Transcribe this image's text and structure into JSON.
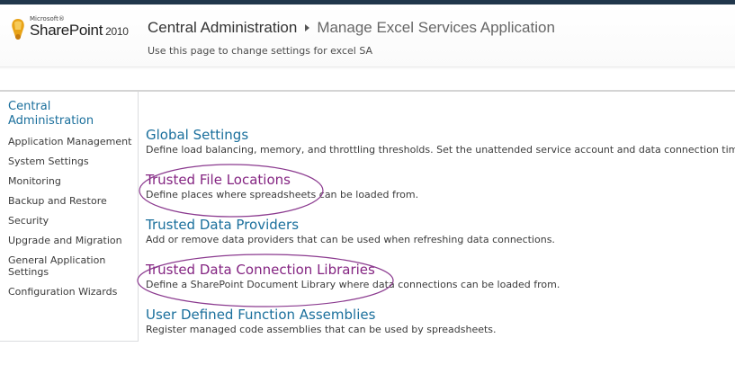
{
  "header": {
    "logo_microsoft": "Microsoft®",
    "logo_product": "SharePoint",
    "logo_year": "2010",
    "breadcrumb_root": "Central Administration",
    "breadcrumb_current": "Manage Excel Services Application",
    "page_description": "Use this page to change settings for excel SA"
  },
  "leftnav": {
    "heading": "Central Administration",
    "items": [
      "Application Management",
      "System Settings",
      "Monitoring",
      "Backup and Restore",
      "Security",
      "Upgrade and Migration",
      "General Application Settings",
      "Configuration Wizards"
    ]
  },
  "sections": [
    {
      "title": "Global Settings",
      "description": "Define load balancing, memory, and throttling thresholds. Set the unattended service account and data connection timeouts."
    },
    {
      "title": "Trusted File Locations",
      "description": "Define places where spreadsheets can be loaded from."
    },
    {
      "title": "Trusted Data Providers",
      "description": "Add or remove data providers that can be used when refreshing data connections."
    },
    {
      "title": "Trusted Data Connection Libraries",
      "description": "Define a SharePoint Document Library where data connections can be loaded from."
    },
    {
      "title": "User Defined Function Assemblies",
      "description": "Register managed code assemblies that can be used by spreadsheets."
    }
  ],
  "colors": {
    "link": "#1a6f9c",
    "visited_link": "#842582",
    "annotation": "#8b3a8f",
    "topbar": "#21374c"
  }
}
